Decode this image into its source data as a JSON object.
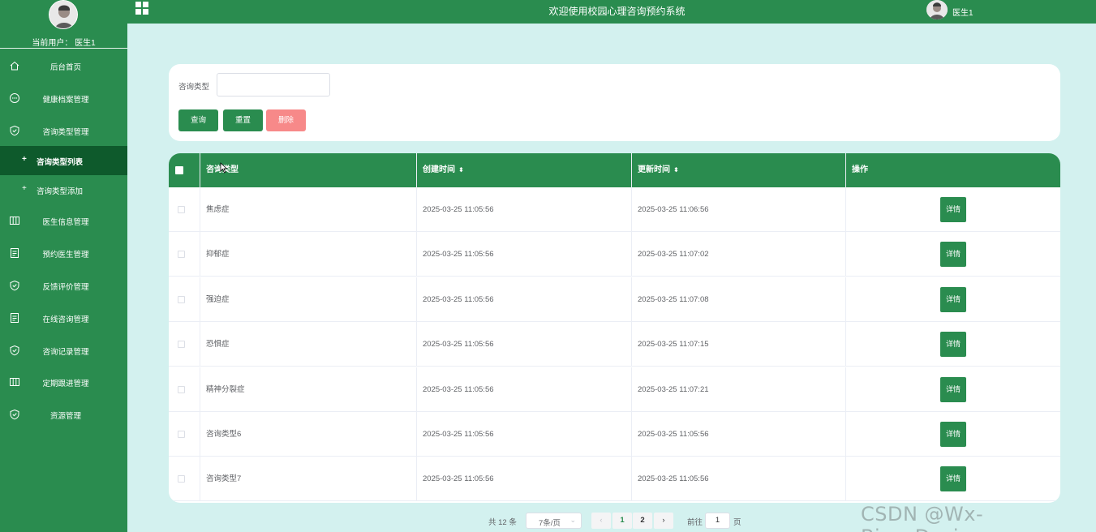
{
  "sidebar": {
    "current_user_label": "当前用户：  医生1",
    "items": [
      {
        "label": "后台首页",
        "icon": "home-icon"
      },
      {
        "label": "健康档案管理",
        "icon": "chat-icon"
      },
      {
        "label": "咨询类型管理",
        "icon": "shield-icon"
      },
      {
        "label": "医生信息管理",
        "icon": "columns-icon"
      },
      {
        "label": "预约医生管理",
        "icon": "document-icon"
      },
      {
        "label": "反馈评价管理",
        "icon": "shield-icon"
      },
      {
        "label": "在线咨询管理",
        "icon": "document-icon"
      },
      {
        "label": "咨询记录管理",
        "icon": "shield-icon"
      },
      {
        "label": "定期跟进管理",
        "icon": "columns-icon"
      },
      {
        "label": "资源管理",
        "icon": "shield-icon"
      }
    ],
    "sub_items": [
      {
        "label": "咨询类型列表",
        "active": true
      },
      {
        "label": "咨询类型添加",
        "active": false
      }
    ]
  },
  "header": {
    "title": "欢迎使用校园心理咨询预约系统",
    "username": "医生1"
  },
  "search": {
    "label": "咨询类型",
    "placeholder": "",
    "query_button": "查询",
    "reset_button": "重置",
    "delete_button": "删除"
  },
  "table": {
    "columns": [
      "咨询类型",
      "创建时间",
      "更新时间",
      "操作"
    ],
    "sort_symbol": "⬍",
    "detail_label": "详情",
    "rows": [
      {
        "type": "焦虑症",
        "created": "2025-03-25 11:05:56",
        "updated": "2025-03-25 11:06:56"
      },
      {
        "type": "抑郁症",
        "created": "2025-03-25 11:05:56",
        "updated": "2025-03-25 11:07:02"
      },
      {
        "type": "强迫症",
        "created": "2025-03-25 11:05:56",
        "updated": "2025-03-25 11:07:08"
      },
      {
        "type": " 恐惧症",
        "created": "2025-03-25 11:05:56",
        "updated": "2025-03-25 11:07:15"
      },
      {
        "type": "精神分裂症",
        "created": "2025-03-25 11:05:56",
        "updated": "2025-03-25 11:07:21"
      },
      {
        "type": "咨询类型6",
        "created": "2025-03-25 11:05:56",
        "updated": "2025-03-25 11:05:56"
      },
      {
        "type": "咨询类型7",
        "created": "2025-03-25 11:05:56",
        "updated": "2025-03-25 11:05:56"
      }
    ]
  },
  "pagination": {
    "total": "共 12 条",
    "page_size": "7条/页",
    "pages": [
      "1",
      "2"
    ],
    "current_page": "1",
    "goto_label": "前往",
    "goto_value": "1",
    "page_suffix": "页"
  },
  "watermark": "CSDN @Wx-Biye_Design",
  "colors": {
    "primary": "#2a8c4f",
    "active_menu": "#0e5a2c",
    "background": "#d3f1ef",
    "danger": "#f78989"
  }
}
